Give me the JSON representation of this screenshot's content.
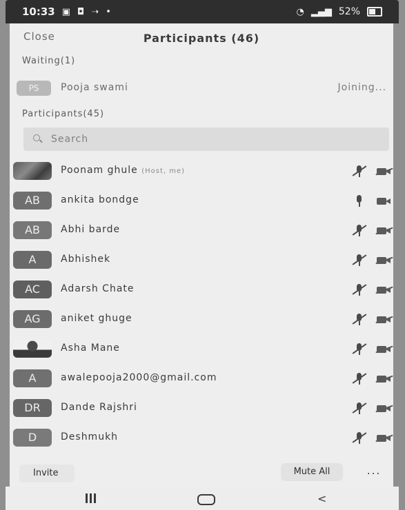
{
  "status_bar": {
    "time": "10:33",
    "battery": "52%"
  },
  "header": {
    "close_label": "Close",
    "title": "Participants (46)"
  },
  "waiting": {
    "section_label": "Waiting(1)",
    "items": [
      {
        "initials": "PS",
        "name": "Pooja swami",
        "status": "Joining..."
      }
    ]
  },
  "participants_section_label": "Participants(45)",
  "search": {
    "placeholder": "Search"
  },
  "participants": [
    {
      "initials": "",
      "name": "Poonam ghule",
      "role": "(Host, me)",
      "avatar_type": "photo"
    },
    {
      "initials": "AB",
      "name": "ankita bondge",
      "role": "",
      "avatar_type": "initials"
    },
    {
      "initials": "AB",
      "name": "Abhi barde",
      "role": "",
      "avatar_type": "initials"
    },
    {
      "initials": "A",
      "name": "Abhishek",
      "role": "",
      "avatar_type": "initials"
    },
    {
      "initials": "AC",
      "name": "Adarsh Chate",
      "role": "",
      "avatar_type": "initials"
    },
    {
      "initials": "AG",
      "name": "aniket ghuge",
      "role": "",
      "avatar_type": "initials"
    },
    {
      "initials": "",
      "name": "Asha Mane",
      "role": "",
      "avatar_type": "photo"
    },
    {
      "initials": "A",
      "name": "awalepooja2000@gmail.com",
      "role": "",
      "avatar_type": "initials"
    },
    {
      "initials": "DR",
      "name": "Dande Rajshri",
      "role": "",
      "avatar_type": "initials"
    },
    {
      "initials": "D",
      "name": "Deshmukh",
      "role": "",
      "avatar_type": "initials"
    }
  ],
  "footer": {
    "invite_label": "Invite",
    "mute_all_label": "Mute All",
    "more_label": "..."
  },
  "colors": {
    "avatar_bg": "#6f6f6f",
    "panel_bg": "#eeeeee",
    "status_bar_bg": "#2e2e2e"
  }
}
